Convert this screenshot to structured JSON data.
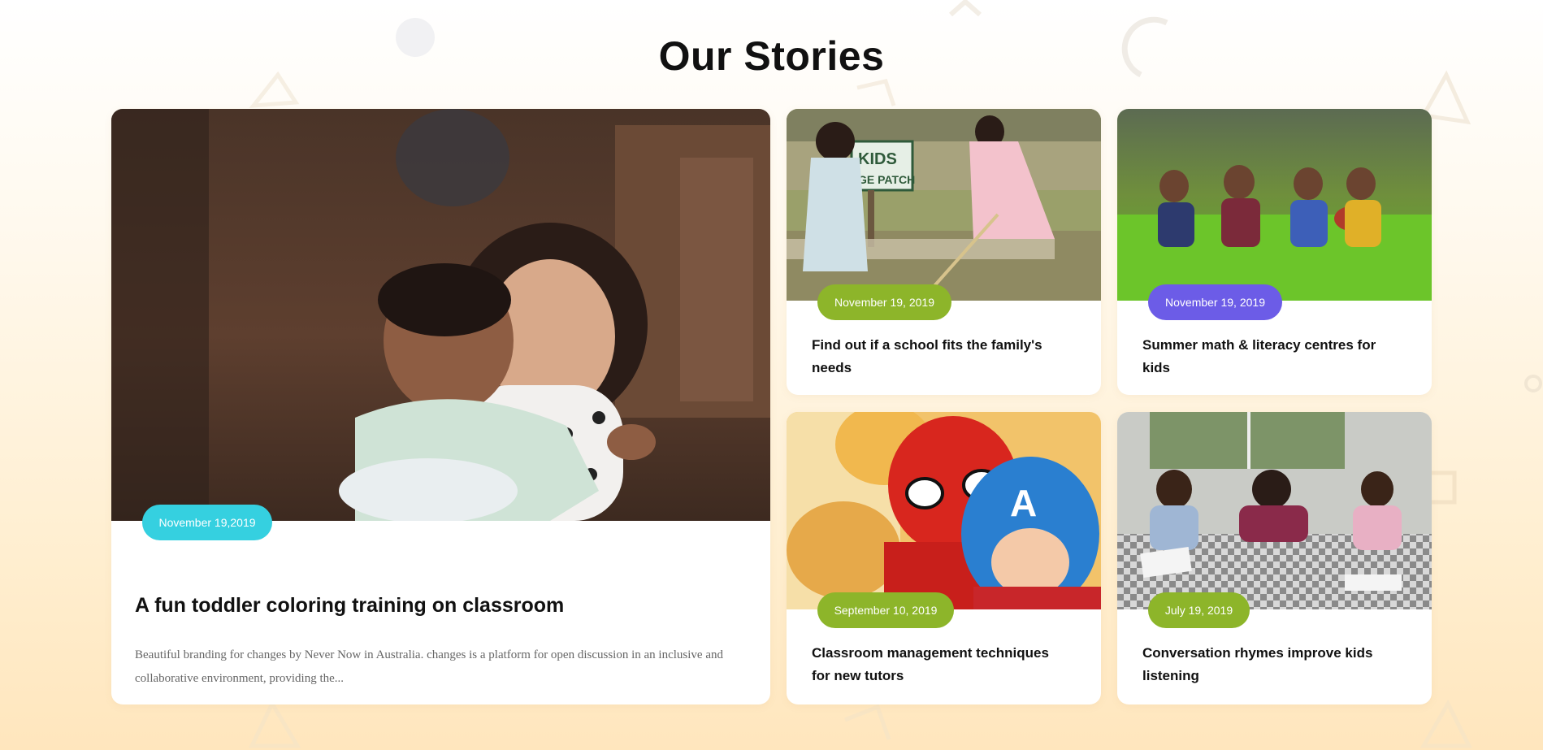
{
  "section": {
    "title": "Our Stories"
  },
  "featured": {
    "date": "November 19,2019",
    "title": "A fun toddler coloring training on classroom",
    "excerpt": "Beautiful branding for changes by Never Now in Australia. changes is a platform for open discussion in an inclusive and collaborative environment, providing the..."
  },
  "stories": [
    {
      "date": "November 19, 2019",
      "title": "Find out if a school fits the family's needs",
      "badge_color": "#8db52a"
    },
    {
      "date": "November 19, 2019",
      "title": "Summer math & literacy centres for kids",
      "badge_color": "#6c5ce7"
    },
    {
      "date": "September 10, 2019",
      "title": "Classroom management techniques for new tutors",
      "badge_color": "#8db52a"
    },
    {
      "date": "July 19, 2019",
      "title": "Conversation rhymes improve kids listening",
      "badge_color": "#8db52a"
    }
  ],
  "colors": {
    "featured_badge": "#35d0e0",
    "green_badge": "#8db52a",
    "purple_badge": "#6c5ce7",
    "photo_sign_text": "KIDS GE PATCH"
  },
  "icons": [
    "circle-shape-icon",
    "triangle-shape-icon",
    "square-shape-icon",
    "arc-shape-icon",
    "chevron-shape-icon"
  ]
}
